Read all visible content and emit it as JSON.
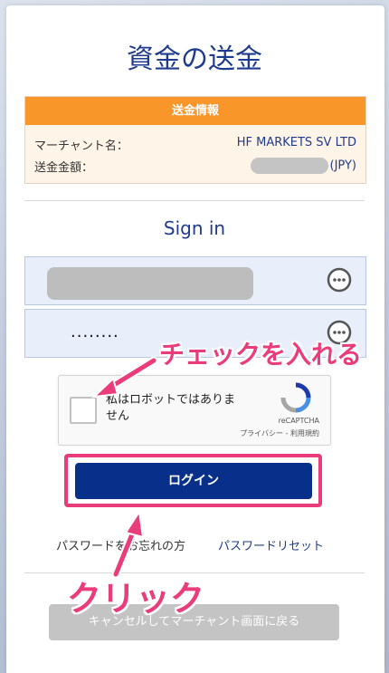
{
  "page": {
    "title": "資金の送金"
  },
  "transfer_info": {
    "header": "送金情報",
    "merchant_label": "マーチャント名：",
    "merchant_value": "HF MARKETS SV LTD",
    "amount_label": "送金金額：",
    "amount_currency": "(JPY)"
  },
  "signin": {
    "heading": "Sign in",
    "password_value": "........",
    "login_button": "ログイン",
    "forgot_password": "パスワードをお忘れの方",
    "reset_password": "パスワードリセット"
  },
  "captcha": {
    "label": "私はロボットではありません",
    "brand": "reCAPTCHA",
    "links": "プライバシー - 利用規約"
  },
  "footer": {
    "back_button": "キャンセルしてマーチャント画面に戻る"
  },
  "annotations": {
    "check_hint": "チェックを入れる",
    "click_hint": "クリック"
  },
  "colors": {
    "brand_blue": "#1f3b8f",
    "button_navy": "#082f8a",
    "info_orange": "#f8962a",
    "annotation_pink": "#ea3c7b"
  },
  "icons": [
    "more-options-icon",
    "recaptcha-icon"
  ]
}
